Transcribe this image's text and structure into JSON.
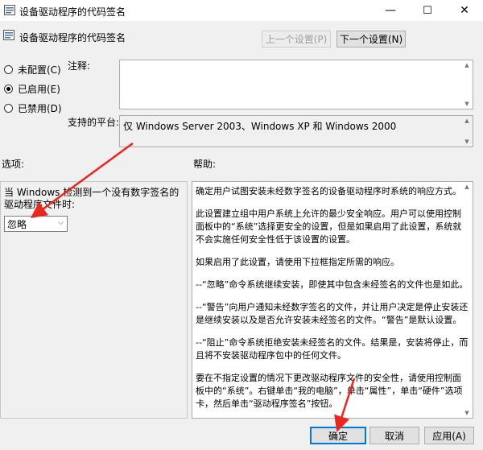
{
  "window": {
    "title": "设备驱动程序的代码签名",
    "minimize": "—",
    "maximize": "☐",
    "close": "✕"
  },
  "header": {
    "policy_name": "设备驱动程序的代码签名",
    "prev_button": "上一个设置(P)",
    "next_button": "下一个设置(N)"
  },
  "state": {
    "not_configured": "未配置(C)",
    "enabled": "已启用(E)",
    "disabled": "已禁用(D)",
    "selected": "enabled"
  },
  "comment": {
    "label": "注释:",
    "value": ""
  },
  "platform": {
    "label": "支持的平台:",
    "value": "仅 Windows Server 2003、Windows XP 和 Windows 2000"
  },
  "options": {
    "label": "选项:",
    "description": "当 Windows 检测到一个没有数字签名的驱动程序文件时:",
    "select_value": "忽略"
  },
  "help": {
    "label": "帮助:",
    "paragraphs": [
      "确定用户试图安装未经数字签名的设备驱动程序时系统的响应方式。",
      "此设置建立组中用户系统上允许的最少安全响应。用户可以使用控制面板中的“系统”选择更安全的设置，但是如果启用了此设置，系统就不会实施任何安全性低于该设置的设置。",
      "如果启用了此设置，请使用下拉框指定所需的响应。",
      "--“忽略”命令系统继续安装，即使其中包含未经签名的文件也是如此。",
      "--“警告”向用户通知未经数字签名的文件，并让用户决定是停止安装还是继续安装以及是否允许安装未经签名的文件。“警告”是默认设置。",
      "--“阻止”命令系统拒绝安装未经签名的文件。结果是，安装将停止，而且将不安装驱动程序包中的任何文件。",
      "要在不指定设置的情况下更改驱动程序文件的安全性，请使用控制面板中的“系统”。右键单击“我的电脑”，单击“属性”，单击“硬件”选项卡，然后单击“驱动程序签名”按钮。"
    ]
  },
  "footer": {
    "ok": "确定",
    "cancel": "取消",
    "apply": "应用(A)"
  },
  "colors": {
    "arrow": "#e8281e",
    "accent": "#0078d7"
  }
}
